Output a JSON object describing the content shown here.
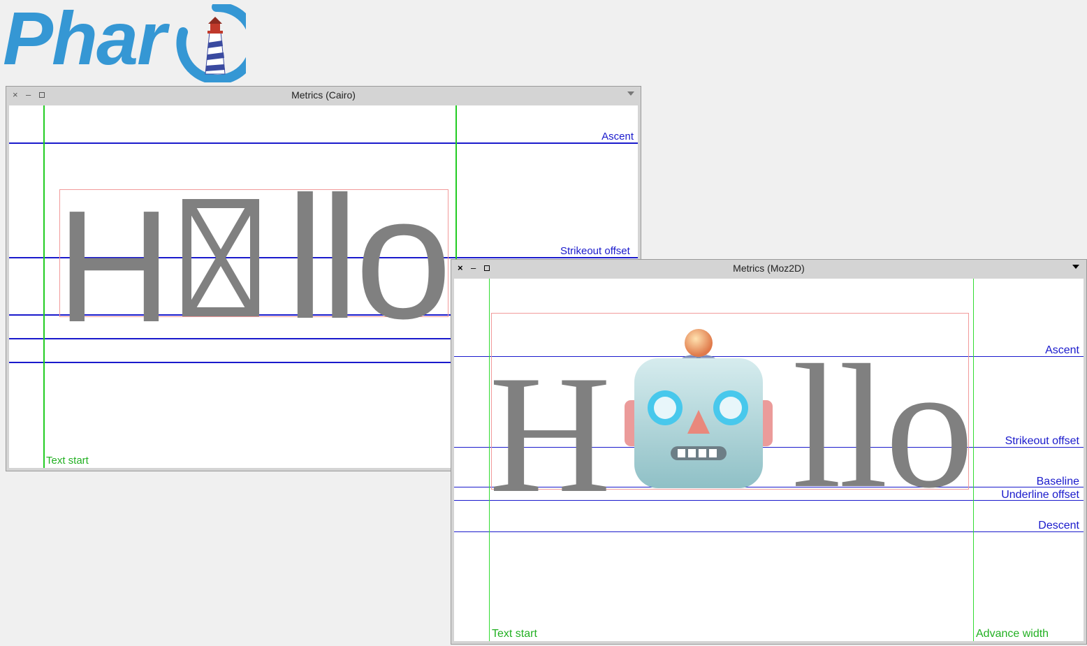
{
  "logo": {
    "text": "Phar",
    "alt_icon": "lighthouse-icon"
  },
  "cairo_window": {
    "title": "Metrics (Cairo)",
    "sample_text_left": "H",
    "sample_text_right": "llo",
    "missing_glyph": "missing-glyph-box-icon",
    "labels": {
      "ascent": "Ascent",
      "strikeout": "Strikeout offset",
      "text_start": "Text start"
    }
  },
  "moz2d_window": {
    "title": "Metrics (Moz2D)",
    "sample_text_left": "H",
    "sample_text_right": "llo",
    "emoji": "robot-face-icon",
    "labels": {
      "ascent": "Ascent",
      "strikeout": "Strikeout offset",
      "baseline": "Baseline",
      "underline": "Underline offset",
      "descent": "Descent",
      "text_start": "Text start",
      "advance_width": "Advance width"
    }
  },
  "colors": {
    "metric_line": "#1a1acc",
    "guide_line": "#22cc22",
    "bounds_box": "#f29a9a",
    "glyph": "#808080"
  }
}
